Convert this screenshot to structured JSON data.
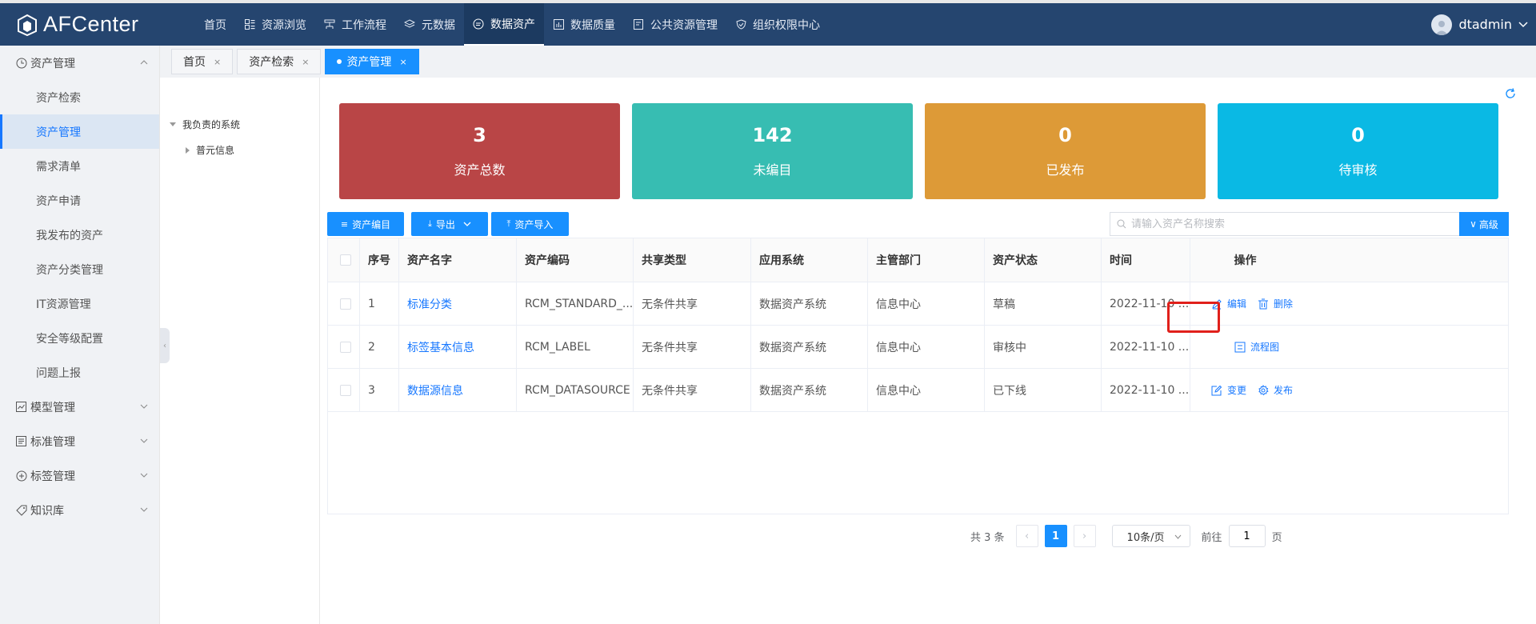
{
  "app": {
    "name": "AFCenter"
  },
  "colors": {
    "header": "#25456f",
    "primary": "#1890ff",
    "stat_total": "#b94546",
    "stat_uncataloged": "#37bdb2",
    "stat_published": "#dd9a37",
    "stat_pending": "#0ab9e4",
    "highlight": "#e0201b"
  },
  "nav": [
    {
      "label": "首页",
      "icon": "none"
    },
    {
      "label": "资源浏览",
      "icon": "grid-icon"
    },
    {
      "label": "工作流程",
      "icon": "workflow-icon"
    },
    {
      "label": "元数据",
      "icon": "layers-icon"
    },
    {
      "label": "数据资产",
      "icon": "asset-icon"
    },
    {
      "label": "数据质量",
      "icon": "chart-icon"
    },
    {
      "label": "公共资源管理",
      "icon": "doc-icon"
    },
    {
      "label": "组织权限中心",
      "icon": "shield-icon"
    }
  ],
  "user": {
    "name": "dtadmin"
  },
  "sidebar": {
    "group_asset": "资产管理",
    "items": [
      "资产检索",
      "资产管理",
      "需求清单",
      "资产申请",
      "我发布的资产",
      "资产分类管理",
      "IT资源管理",
      "安全等级配置",
      "问题上报"
    ],
    "group_model": "模型管理",
    "group_standard": "标准管理",
    "group_tag": "标签管理",
    "group_knowledge": "知识库"
  },
  "tabs": [
    {
      "label": "首页"
    },
    {
      "label": "资产检索"
    },
    {
      "label": "资产管理"
    }
  ],
  "tab_close": "×",
  "tree": {
    "root": "我负责的系统",
    "child": "普元信息"
  },
  "stats": [
    {
      "num": "3",
      "label": "资产总数"
    },
    {
      "num": "142",
      "label": "未编目"
    },
    {
      "num": "0",
      "label": "已发布"
    },
    {
      "num": "0",
      "label": "待审核"
    }
  ],
  "toolbar": {
    "catalog": "资产编目",
    "export": "导出",
    "import": "资产导入",
    "search_placeholder": "请输入资产名称搜索",
    "advanced": "高级"
  },
  "table": {
    "headers": [
      "序号",
      "资产名字",
      "资产编码",
      "共享类型",
      "应用系统",
      "主管部门",
      "资产状态",
      "时间",
      "操作"
    ],
    "rows": [
      {
        "no": "1",
        "name": "标准分类",
        "code": "RCM_STANDARD_...",
        "share": "无条件共享",
        "system": "数据资产系统",
        "dept": "信息中心",
        "status": "草稿",
        "time": "2022-11-10 ...",
        "ops": [
          "编辑",
          "删除"
        ]
      },
      {
        "no": "2",
        "name": "标签基本信息",
        "code": "RCM_LABEL",
        "share": "无条件共享",
        "system": "数据资产系统",
        "dept": "信息中心",
        "status": "审核中",
        "time": "2022-11-10 ...",
        "ops": [
          "流程图"
        ]
      },
      {
        "no": "3",
        "name": "数据源信息",
        "code": "RCM_DATASOURCE",
        "share": "无条件共享",
        "system": "数据资产系统",
        "dept": "信息中心",
        "status": "已下线",
        "time": "2022-11-10 ...",
        "ops": [
          "变更",
          "发布"
        ]
      }
    ]
  },
  "pagination": {
    "total": "共 3 条",
    "current": "1",
    "page_size": "10条/页",
    "goto": "前往",
    "goto_value": "1",
    "page_unit": "页"
  }
}
